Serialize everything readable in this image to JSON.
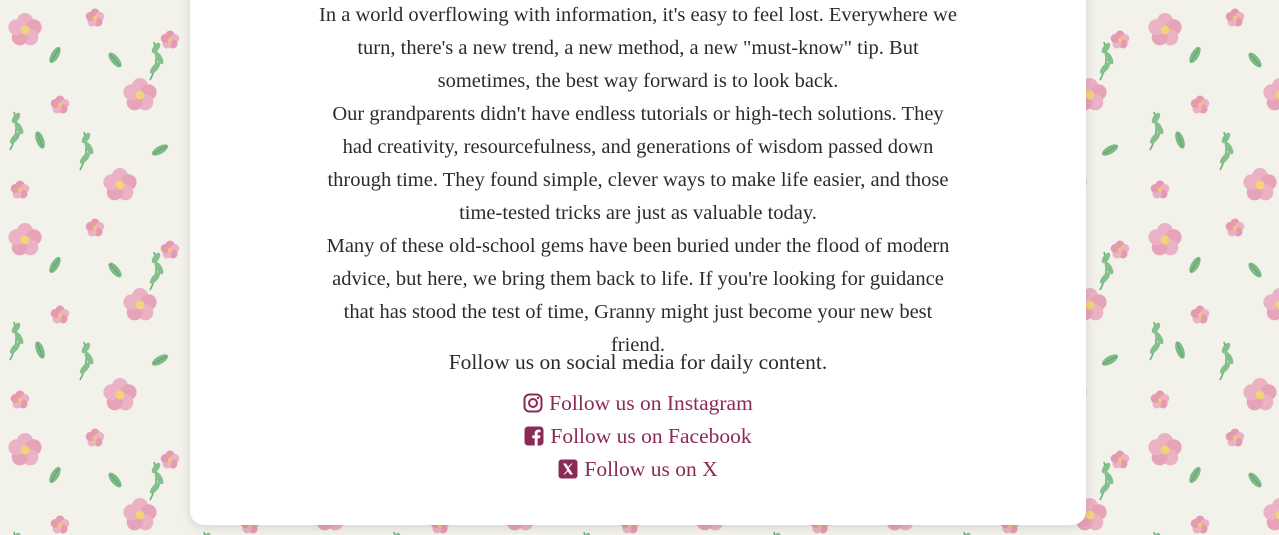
{
  "colors": {
    "background": "#f2f1ea",
    "card": "#ffffff",
    "text": "#2b2b2b",
    "link": "#8c2a57",
    "flower_pink": "#e7a3b8",
    "leaf_green": "#6fae7a"
  },
  "story": {
    "paragraphs": [
      "In a world overflowing with information, it's easy to feel lost. Everywhere we turn, there's a new trend, a new method, a new \"must-know\" tip. But sometimes, the best way forward is to look back.",
      "Our grandparents didn't have endless tutorials or high-tech solutions. They had creativity, resourcefulness, and generations of wisdom passed down through time. They found simple, clever ways to make life easier, and those time-tested tricks are just as valuable today.",
      "Many of these old-school gems have been buried under the flood of modern advice, but here, we bring them back to life. If you're looking for guidance that has stood the test of time, Granny might just become your new best friend."
    ]
  },
  "follow": {
    "text": "Follow us on social media for daily content.",
    "links": [
      {
        "label": "Follow us on Instagram",
        "icon": "instagram-icon"
      },
      {
        "label": "Follow us on Facebook",
        "icon": "facebook-icon"
      },
      {
        "label": "Follow us on X",
        "icon": "x-icon"
      }
    ]
  }
}
